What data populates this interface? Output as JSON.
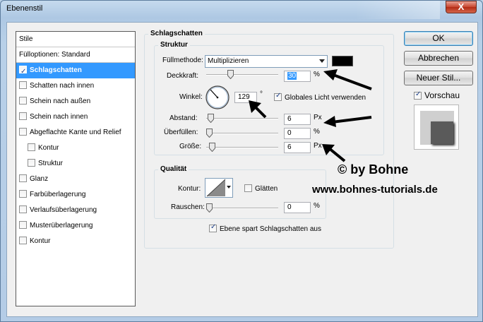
{
  "window": {
    "title": "Ebenenstil",
    "close_glyph": "X"
  },
  "style_list": {
    "header": "Stile",
    "options": "Fülloptionen: Standard",
    "items": [
      {
        "label": "Schlagschatten",
        "checked": true,
        "selected": true,
        "indent": false
      },
      {
        "label": "Schatten nach innen",
        "checked": false,
        "indent": false
      },
      {
        "label": "Schein nach außen",
        "checked": false,
        "indent": false
      },
      {
        "label": "Schein nach innen",
        "checked": false,
        "indent": false
      },
      {
        "label": "Abgeflachte Kante und Relief",
        "checked": false,
        "indent": false
      },
      {
        "label": "Kontur",
        "checked": false,
        "indent": true
      },
      {
        "label": "Struktur",
        "checked": false,
        "indent": true
      },
      {
        "label": "Glanz",
        "checked": false,
        "indent": false
      },
      {
        "label": "Farbüberlagerung",
        "checked": false,
        "indent": false
      },
      {
        "label": "Verlaufsüberlagerung",
        "checked": false,
        "indent": false
      },
      {
        "label": "Musterüberlagerung",
        "checked": false,
        "indent": false
      },
      {
        "label": "Kontur",
        "checked": false,
        "indent": false
      }
    ]
  },
  "panel": {
    "title": "Schlagschatten",
    "structure": {
      "title": "Struktur",
      "blend_mode_label": "Füllmethode:",
      "blend_mode_value": "Multiplizieren",
      "shadow_color": "#000000",
      "opacity_label": "Deckkraft:",
      "opacity_value": "30",
      "opacity_unit": "%",
      "angle_label": "Winkel:",
      "angle_value": "129",
      "angle_unit": "°",
      "global_light_label": "Globales Licht verwenden",
      "global_light_checked": true,
      "distance_label": "Abstand:",
      "distance_value": "6",
      "distance_unit": "Px",
      "spread_label": "Überfüllen:",
      "spread_value": "0",
      "spread_unit": "%",
      "size_label": "Größe:",
      "size_value": "6",
      "size_unit": "Px"
    },
    "quality": {
      "title": "Qualität",
      "contour_label": "Kontur:",
      "antialias_label": "Glätten",
      "antialias_checked": false,
      "noise_label": "Rauschen:",
      "noise_value": "0",
      "noise_unit": "%"
    },
    "knockout_label": "Ebene spart Schlagschatten aus",
    "knockout_checked": true
  },
  "buttons": {
    "ok": "OK",
    "cancel": "Abbrechen",
    "new_style": "Neuer Stil..."
  },
  "preview": {
    "label": "Vorschau",
    "checked": true
  },
  "watermark": {
    "author": "© by Bohne",
    "url": "www.bohnes-tutorials.de"
  },
  "colors": {
    "selection": "#3399ff",
    "dialog_bg": "#f0f0f0"
  }
}
